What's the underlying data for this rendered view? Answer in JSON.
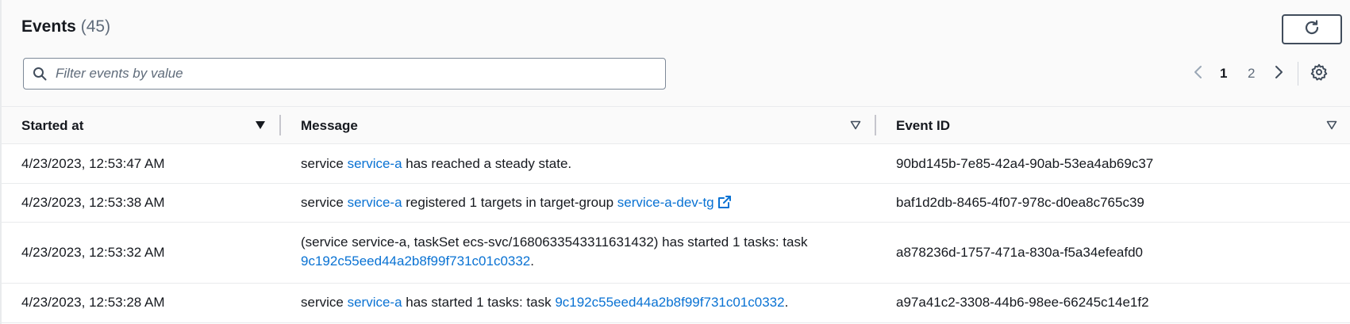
{
  "header": {
    "title": "Events",
    "count": "(45)",
    "search_placeholder": "Filter events by value"
  },
  "pagination": {
    "pages": [
      "1",
      "2"
    ],
    "current": "1"
  },
  "columns": {
    "started_at": "Started at",
    "message": "Message",
    "event_id": "Event ID"
  },
  "rows": [
    {
      "started_at": "4/23/2023, 12:53:47 AM",
      "msg": {
        "t1": "service ",
        "l1": "service-a",
        "t2": " has reached a steady state."
      },
      "event_id": "90bd145b-7e85-42a4-90ab-53ea4ab69c37"
    },
    {
      "started_at": "4/23/2023, 12:53:38 AM",
      "msg": {
        "t1": "service ",
        "l1": "service-a",
        "t2": " registered 1 targets in target-group ",
        "l2": "service-a-dev-tg"
      },
      "event_id": "baf1d2db-8465-4f07-978c-d0ea8c765c39"
    },
    {
      "started_at": "4/23/2023, 12:53:32 AM",
      "msg": {
        "t1": "(service service-a, taskSet ecs-svc/1680633543311631432) has started 1 tasks: task",
        "l1": "9c192c55eed44a2b8f99f731c01c0332",
        "t2": "."
      },
      "event_id": "a878236d-1757-471a-830a-f5a34efeafd0"
    },
    {
      "started_at": "4/23/2023, 12:53:28 AM",
      "msg": {
        "t1": "service ",
        "l1": "service-a",
        "t2": " has started 1 tasks: task ",
        "l2": "9c192c55eed44a2b8f99f731c01c0332",
        "t3": "."
      },
      "event_id": "a97a41c2-3308-44b6-98ee-66245c14e1f2"
    }
  ],
  "colors": {
    "link": "#0972d3",
    "text": "#16191f",
    "muted": "#5f6b7a",
    "border": "#e9ebed"
  },
  "icons": [
    "refresh-icon",
    "search-icon",
    "chevron-left-icon",
    "chevron-right-icon",
    "settings-icon",
    "sort-descending-icon",
    "sort-icon",
    "external-link-icon"
  ]
}
